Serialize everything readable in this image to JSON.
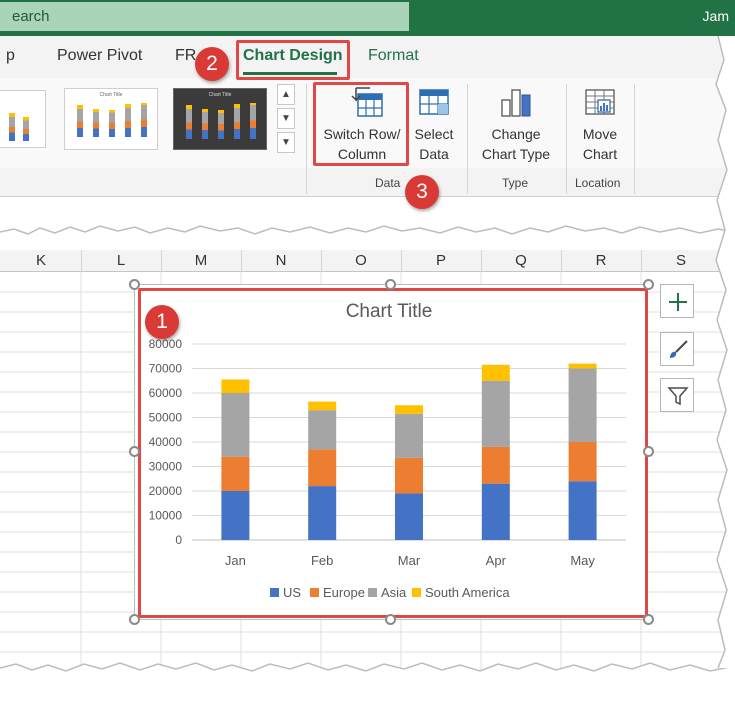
{
  "title_bar": {
    "search_text": "earch",
    "user_name": "Jam"
  },
  "tabs": [
    {
      "label": "p"
    },
    {
      "label": "Power Pivot"
    },
    {
      "label": "FR"
    },
    {
      "label": "Chart Design"
    },
    {
      "label": "Format"
    }
  ],
  "ribbon": {
    "switch_row_col": {
      "line1": "Switch Row/",
      "line2": "Column"
    },
    "select_data": {
      "line1": "Select",
      "line2": "Data"
    },
    "change_chart_type": {
      "line1": "Change",
      "line2": "Chart Type"
    },
    "move_chart": {
      "line1": "Move",
      "line2": "Chart"
    },
    "groups": {
      "data": "Data",
      "type": "Type",
      "location": "Location"
    },
    "gallery_thumb_title": "Chart Title",
    "gallery_thumb_dark_title": "Chart Title"
  },
  "columns": [
    "K",
    "L",
    "M",
    "N",
    "O",
    "P",
    "Q",
    "R",
    "S"
  ],
  "badges": [
    "1",
    "2",
    "3"
  ],
  "colors": {
    "excel_green": "#217346",
    "highlight_red": "#e04848",
    "badge_red": "#d93a35",
    "us": "#4472c4",
    "europe": "#ed7d31",
    "asia": "#a5a5a5",
    "south_america": "#ffc000"
  },
  "side_buttons": [
    "plus-icon",
    "brush-icon",
    "filter-icon"
  ],
  "chart_data": {
    "type": "bar",
    "stacked": true,
    "title": "Chart Title",
    "categories": [
      "Jan",
      "Feb",
      "Mar",
      "Apr",
      "May"
    ],
    "series": [
      {
        "name": "US",
        "values": [
          20000,
          22000,
          19000,
          23000,
          24000
        ]
      },
      {
        "name": "Europe",
        "values": [
          14000,
          15000,
          14500,
          15000,
          16000
        ]
      },
      {
        "name": "Asia",
        "values": [
          26000,
          16000,
          18000,
          27000,
          30000
        ]
      },
      {
        "name": "South America",
        "values": [
          5500,
          3500,
          3500,
          6500,
          2000
        ]
      }
    ],
    "yticks": [
      "0",
      "10000",
      "20000",
      "30000",
      "40000",
      "50000",
      "60000",
      "70000",
      "80000"
    ],
    "ylim": [
      0,
      80000
    ],
    "grid": true,
    "legend": "bottom"
  }
}
